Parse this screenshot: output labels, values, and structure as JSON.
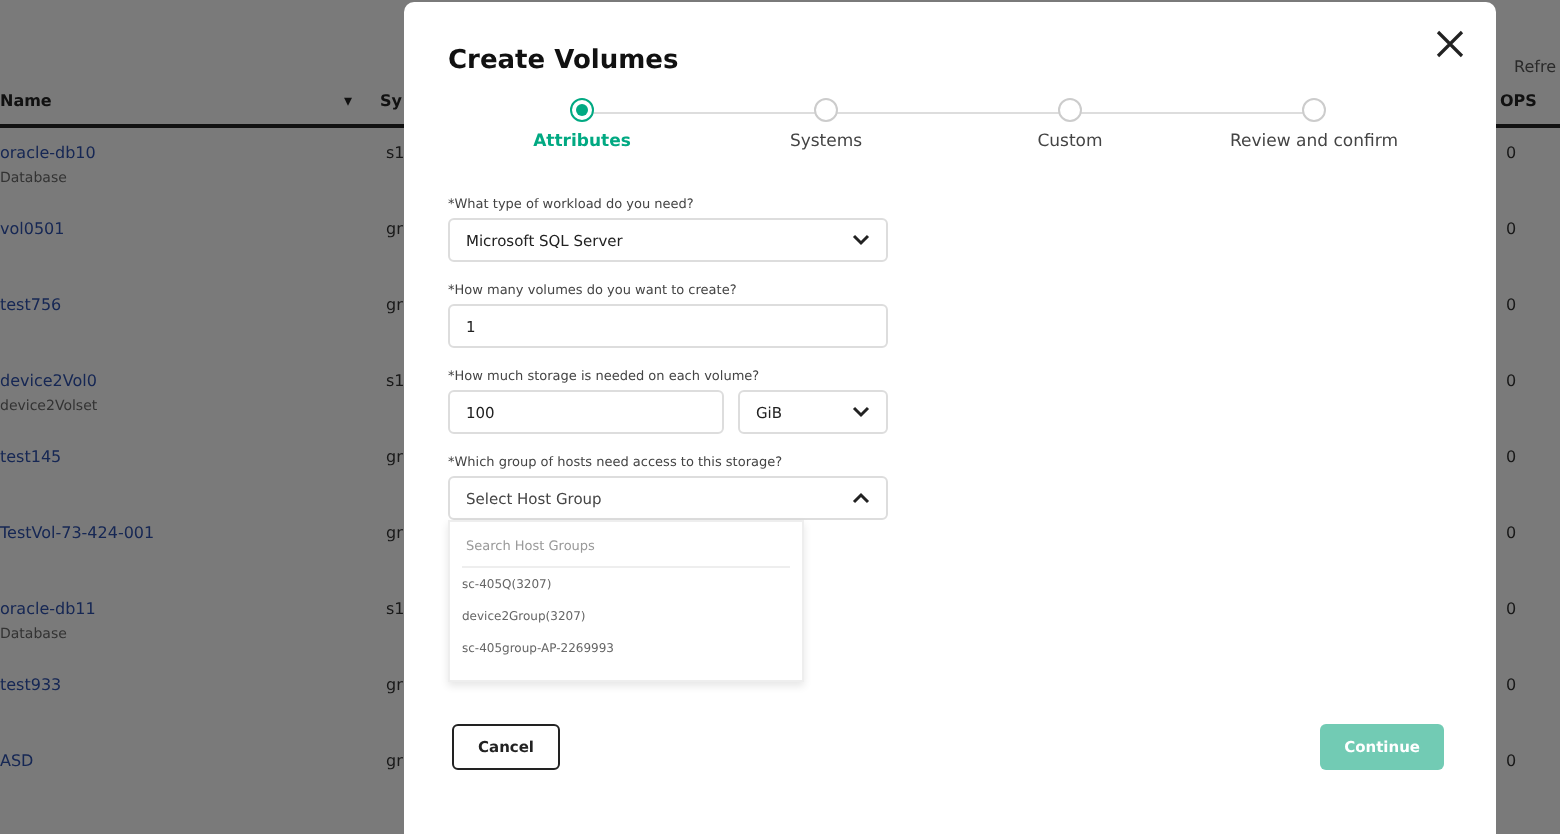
{
  "background_table": {
    "columns": [
      {
        "label": "Name",
        "sort": "▾"
      },
      {
        "label": "Sy"
      },
      {
        "label": "OPS"
      }
    ],
    "top_right": "Refre",
    "rows": [
      {
        "name": "oracle-db10",
        "subtitle": "Database",
        "column_2": "s1",
        "column_3": "0"
      },
      {
        "name": "vol0501",
        "column_2": "gr",
        "column_3": "0"
      },
      {
        "name": "test756",
        "column_2": "gr",
        "column_3": "0"
      },
      {
        "name": "device2Vol0",
        "subtitle": "device2Volset",
        "column_2": "s1",
        "column_3": "0"
      },
      {
        "name": "test145",
        "column_2": "gr",
        "column_3": "0"
      },
      {
        "name": "TestVol-73-424-001",
        "column_2": "gr",
        "column_3": "0"
      },
      {
        "name": "oracle-db11",
        "subtitle": "Database",
        "column_2": "s1",
        "column_3": "0"
      },
      {
        "name": "test933",
        "column_2": "gr",
        "column_3": "0"
      },
      {
        "name": "ASD",
        "column_2": "gr",
        "column_3": "0"
      }
    ]
  },
  "dialog": {
    "title": "Create Volumes",
    "steps": [
      {
        "label": "Attributes",
        "selected": true
      },
      {
        "label": "Systems",
        "selected": false
      },
      {
        "label": "Custom",
        "selected": false
      },
      {
        "label": "Review and confirm",
        "selected": false
      }
    ],
    "fields": [
      {
        "kind": "select",
        "label": "*What type of workload do you need?",
        "value": "Microsoft SQL Server",
        "expanded": false
      },
      {
        "kind": "input",
        "label": "*How many volumes do you want to create?",
        "value": "1"
      },
      {
        "kind": "size",
        "label": "*How much storage is needed on each volume?",
        "value": "100",
        "unit": "GiB"
      },
      {
        "kind": "select",
        "label": "*Which group of hosts need access to this storage?",
        "placeholder": "Select Host Group",
        "expanded": true
      }
    ],
    "dropdown": {
      "search_placeholder": "Search Host Groups",
      "options": [
        "sc-405Q(3207)",
        "device2Group(3207)",
        "sc-405group-AP-2269993"
      ]
    },
    "buttons": [
      {
        "label": "Cancel",
        "kind": "secondary"
      },
      {
        "label": "Continue",
        "kind": "primary",
        "disabled": true
      }
    ]
  }
}
